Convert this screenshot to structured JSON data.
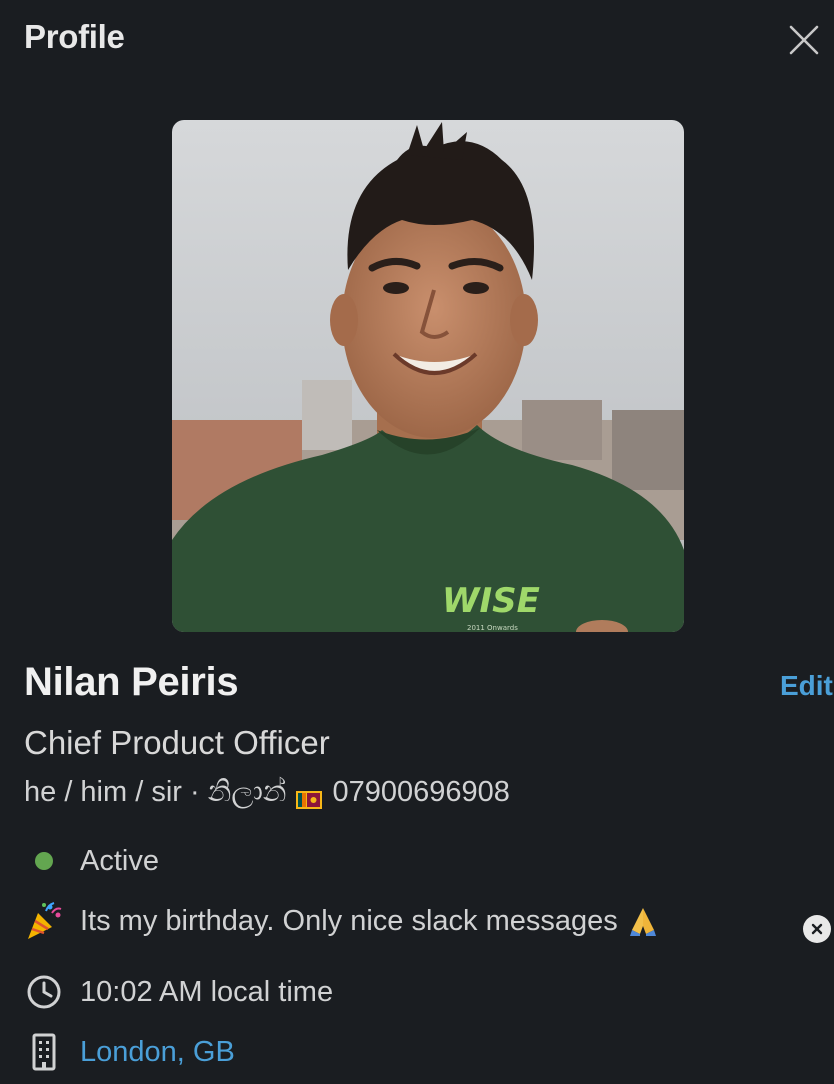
{
  "header": {
    "title": "Profile"
  },
  "profile": {
    "name": "Nilan Peiris",
    "title": "Chief Product Officer",
    "pronouns": "he / him / sir · නිලාන්",
    "phone": "07900696908",
    "edit_label": "Edit"
  },
  "status": {
    "presence": "Active",
    "presence_color": "#63a650",
    "custom_status": "Its my birthday. Only nice slack messages",
    "custom_emoji": "party-popper-icon",
    "trailing_emoji": "folded-hands-icon"
  },
  "details": {
    "local_time": "10:02 AM local time",
    "location": "London, GB"
  },
  "photo": {
    "shirt_logo": "WISE",
    "shirt_small_text": "2011   Onwards"
  },
  "colors": {
    "background": "#1a1d21",
    "link": "#4a9fd8",
    "shirt": "#2f5035"
  }
}
